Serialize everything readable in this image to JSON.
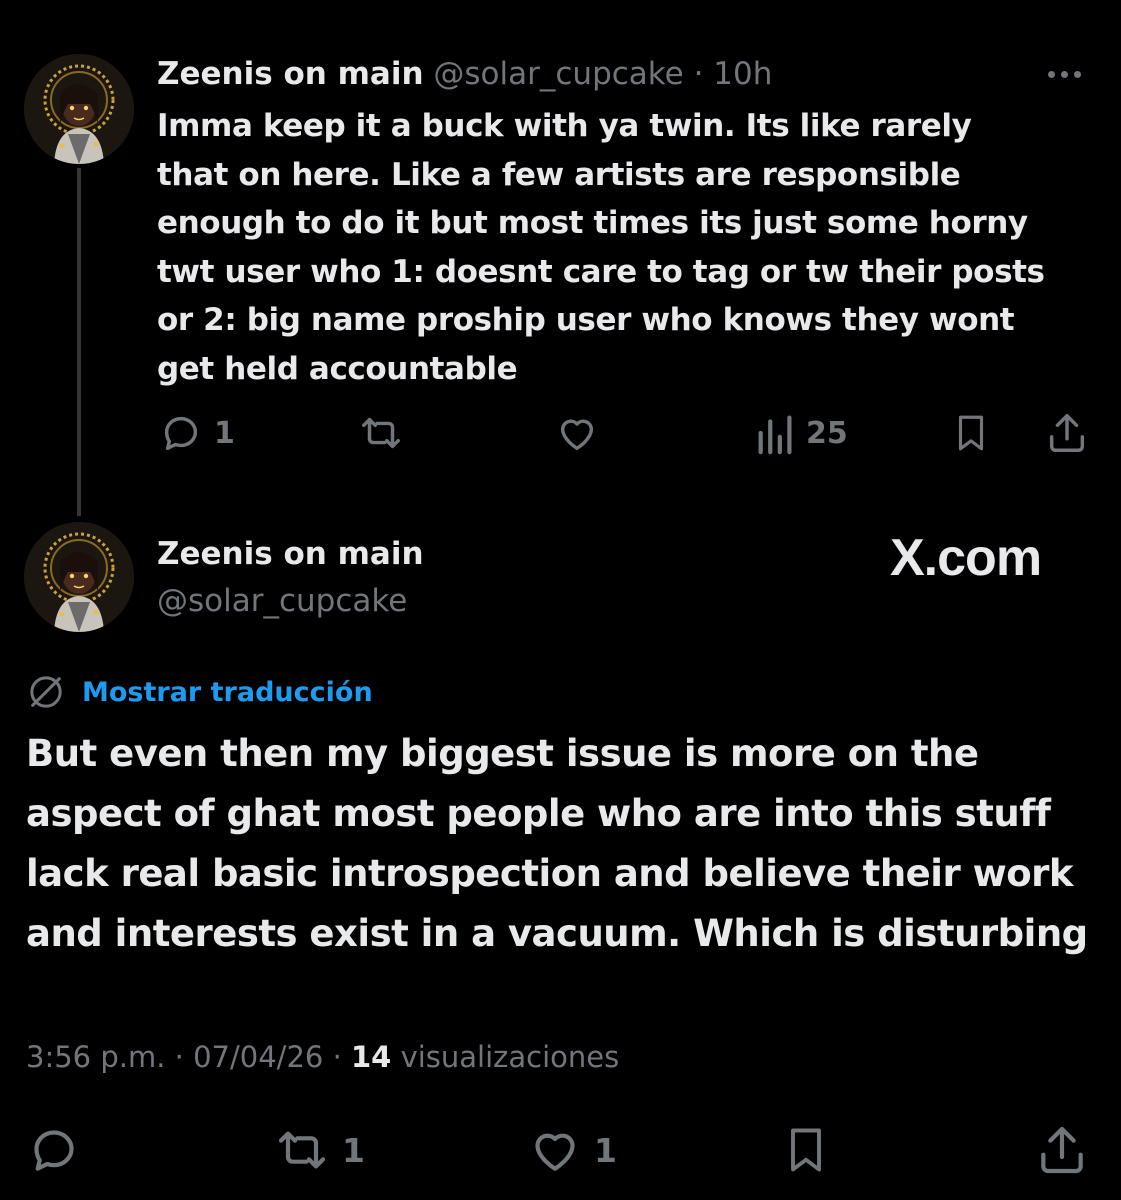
{
  "tweet1": {
    "name": "Zeenis on main",
    "handle": "@solar_cupcake",
    "separator": "·",
    "time": "10h",
    "text_lines": [
      "Imma keep it a buck with ya twin. Its like rarely",
      "that on here. Like a few artists are responsible",
      "enough to do it but most times its just some horny",
      "twt user who 1: doesnt care to tag or tw their posts",
      "or 2: big name proship user who knows they wont",
      "get held accountable"
    ],
    "replies": "1",
    "views": "25"
  },
  "tweet2": {
    "name": "Zeenis on main",
    "handle": "@solar_cupcake",
    "brand": "X.com",
    "translate_label": "Mostrar traducción",
    "text_lines": [
      "But even then my biggest issue is more on the",
      "aspect of ghat most people who are into this stuff",
      "lack real basic introspection and believe their work",
      "and interests exist in a vacuum. Which is disturbing"
    ],
    "time": "3:56 p.m.",
    "date": "07/04/26",
    "separator": "·",
    "views_count": "14",
    "views_label": "visualizaciones",
    "retweets": "1",
    "likes": "1"
  },
  "colors": {
    "background": "#000000",
    "text": "#e7e9ea",
    "muted": "#71767b",
    "link": "#1d9bf0",
    "thread_line": "#333639"
  }
}
